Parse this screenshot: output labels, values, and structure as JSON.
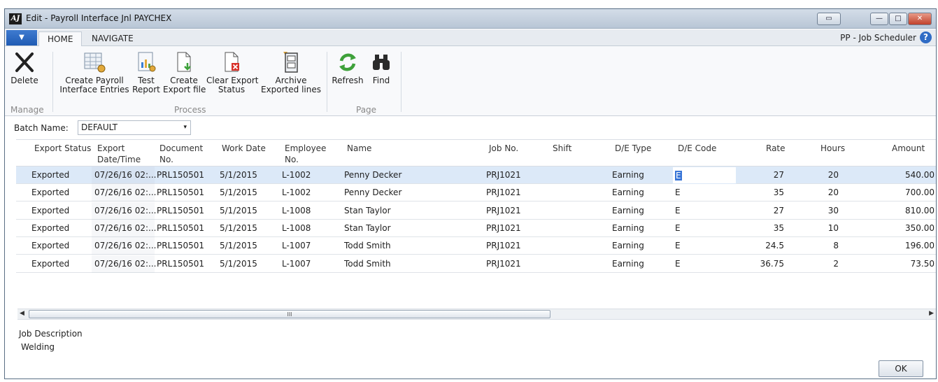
{
  "window": {
    "title": "Edit - Payroll Interface Jnl PAYCHEX",
    "logo_text": "AJ",
    "controls": {
      "restore_glyph": "▭",
      "minimize_glyph": "—",
      "maximize_glyph": "□",
      "close_glyph": "✕"
    }
  },
  "ribbon_tabs": {
    "menu_glyph": "▼",
    "tabs": [
      {
        "label": "HOME"
      },
      {
        "label": "NAVIGATE"
      }
    ],
    "company": "PP - Job Scheduler",
    "help_glyph": "?"
  },
  "ribbon": {
    "buttons": {
      "delete": "Delete",
      "create_payroll": "Create Payroll\nInterface Entries",
      "test_report": "Test\nReport",
      "create_export": "Create\nExport file",
      "clear_export": "Clear Export\nStatus",
      "archive": "Archive\nExported lines",
      "refresh": "Refresh",
      "find": "Find"
    },
    "groups": {
      "manage": "Manage",
      "process": "Process",
      "page": "Page"
    }
  },
  "batch": {
    "label": "Batch Name:",
    "value": "DEFAULT",
    "arrow": "▾"
  },
  "grid": {
    "headers": {
      "export_status": "Export Status",
      "export_datetime": "Export\nDate/Time",
      "document_no": "Document\nNo.",
      "work_date": "Work Date",
      "employee_no": "Employee\nNo.",
      "name": "Name",
      "job_no": "Job No.",
      "shift": "Shift",
      "de_type": "D/E Type",
      "de_code": "D/E Code",
      "rate": "Rate",
      "hours": "Hours",
      "amount": "Amount"
    },
    "rows": [
      {
        "status": "Exported",
        "datetime": "07/26/16 02:...",
        "doc": "PRL150501",
        "work_date": "5/1/2015",
        "emp": "L-1002",
        "name": "Penny Decker",
        "job": "PRJ1021",
        "shift": "",
        "de_type": "Earning",
        "de_code": "E",
        "rate": "27",
        "hours": "20",
        "amount": "540.00"
      },
      {
        "status": "Exported",
        "datetime": "07/26/16 02:...",
        "doc": "PRL150501",
        "work_date": "5/1/2015",
        "emp": "L-1002",
        "name": "Penny Decker",
        "job": "PRJ1021",
        "shift": "",
        "de_type": "Earning",
        "de_code": "E",
        "rate": "35",
        "hours": "20",
        "amount": "700.00"
      },
      {
        "status": "Exported",
        "datetime": "07/26/16 02:...",
        "doc": "PRL150501",
        "work_date": "5/1/2015",
        "emp": "L-1008",
        "name": "Stan Taylor",
        "job": "PRJ1021",
        "shift": "",
        "de_type": "Earning",
        "de_code": "E",
        "rate": "27",
        "hours": "30",
        "amount": "810.00"
      },
      {
        "status": "Exported",
        "datetime": "07/26/16 02:...",
        "doc": "PRL150501",
        "work_date": "5/1/2015",
        "emp": "L-1008",
        "name": "Stan Taylor",
        "job": "PRJ1021",
        "shift": "",
        "de_type": "Earning",
        "de_code": "E",
        "rate": "35",
        "hours": "10",
        "amount": "350.00"
      },
      {
        "status": "Exported",
        "datetime": "07/26/16 02:...",
        "doc": "PRL150501",
        "work_date": "5/1/2015",
        "emp": "L-1007",
        "name": "Todd Smith",
        "job": "PRJ1021",
        "shift": "",
        "de_type": "Earning",
        "de_code": "E",
        "rate": "24.5",
        "hours": "8",
        "amount": "196.00"
      },
      {
        "status": "Exported",
        "datetime": "07/26/16 02:...",
        "doc": "PRL150501",
        "work_date": "5/1/2015",
        "emp": "L-1007",
        "name": "Todd Smith",
        "job": "PRJ1021",
        "shift": "",
        "de_type": "Earning",
        "de_code": "E",
        "rate": "36.75",
        "hours": "2",
        "amount": "73.50"
      }
    ]
  },
  "scrollbar": {
    "left_arrow": "◀",
    "right_arrow": "▶",
    "thumb_grip": "III"
  },
  "details": {
    "job_description_label": "Job Description",
    "job_description_value": "Welding"
  },
  "footer": {
    "ok_label": "OK"
  },
  "colors": {
    "selection": "#dce9f8",
    "accent": "#3875d7",
    "app_menu": "#2f6cc5"
  }
}
